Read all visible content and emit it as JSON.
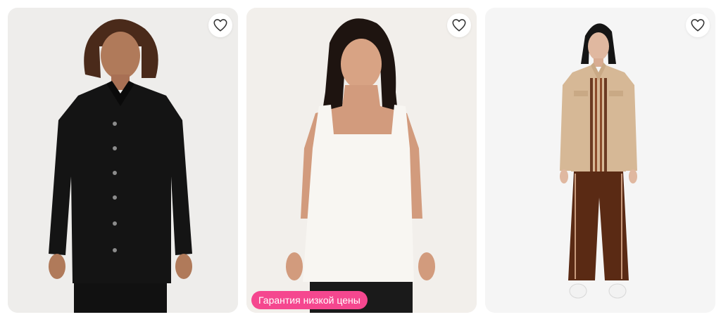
{
  "products": [
    {
      "alt": "Black long-sleeve button shirt",
      "favorite_icon": "heart-outline-icon"
    },
    {
      "alt": "White sleeveless square-neck top",
      "favorite_icon": "heart-outline-icon",
      "badge": {
        "label": "Гарантия низкой цены",
        "color": "#f5478f"
      }
    },
    {
      "alt": "Beige zip jacket with brown trousers",
      "favorite_icon": "heart-outline-icon"
    }
  ]
}
